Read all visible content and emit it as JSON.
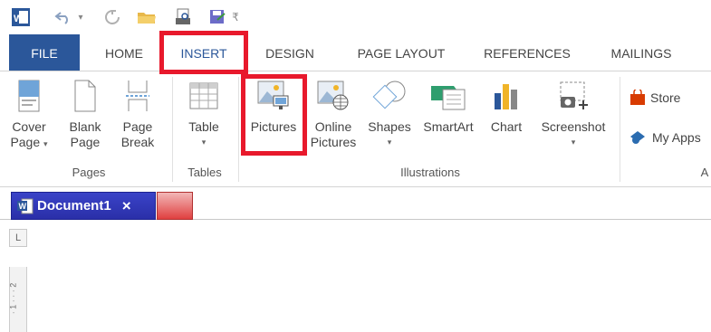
{
  "quick_access": {
    "icons": [
      "word-app-icon",
      "undo-icon",
      "redo-icon",
      "open-folder-icon",
      "print-preview-icon",
      "save-as-icon",
      "customize-toolbar-icon"
    ],
    "dropdown_glyph": "▾",
    "customize_glyph": "₹"
  },
  "tabs": [
    "FILE",
    "HOME",
    "INSERT",
    "DESIGN",
    "PAGE LAYOUT",
    "REFERENCES",
    "MAILINGS"
  ],
  "ribbon": {
    "pages": {
      "label": "Pages",
      "cover_line1": "Cover",
      "cover_line2": "Page",
      "blank_line1": "Blank",
      "blank_line2": "Page",
      "break_line1": "Page",
      "break_line2": "Break"
    },
    "tables": {
      "label": "Tables",
      "table": "Table"
    },
    "illustrations": {
      "label": "Illustrations",
      "pictures": "Pictures",
      "online_line1": "Online",
      "online_line2": "Pictures",
      "shapes": "Shapes",
      "smartart": "SmartArt",
      "chart": "Chart",
      "screenshot": "Screenshot"
    },
    "apps": {
      "store": "Store",
      "my_apps": "My Apps",
      "label_partial": "A"
    },
    "dropdown_caret": "▾"
  },
  "document_tab": {
    "title": "Document1",
    "close": "×"
  },
  "ruler": {
    "corner": "L",
    "vertical_marks": "· 1 · · · 2"
  },
  "colors": {
    "file_tab": "#2b579a",
    "highlight": "#e8192c",
    "doc_tab": "#2f37b8"
  }
}
